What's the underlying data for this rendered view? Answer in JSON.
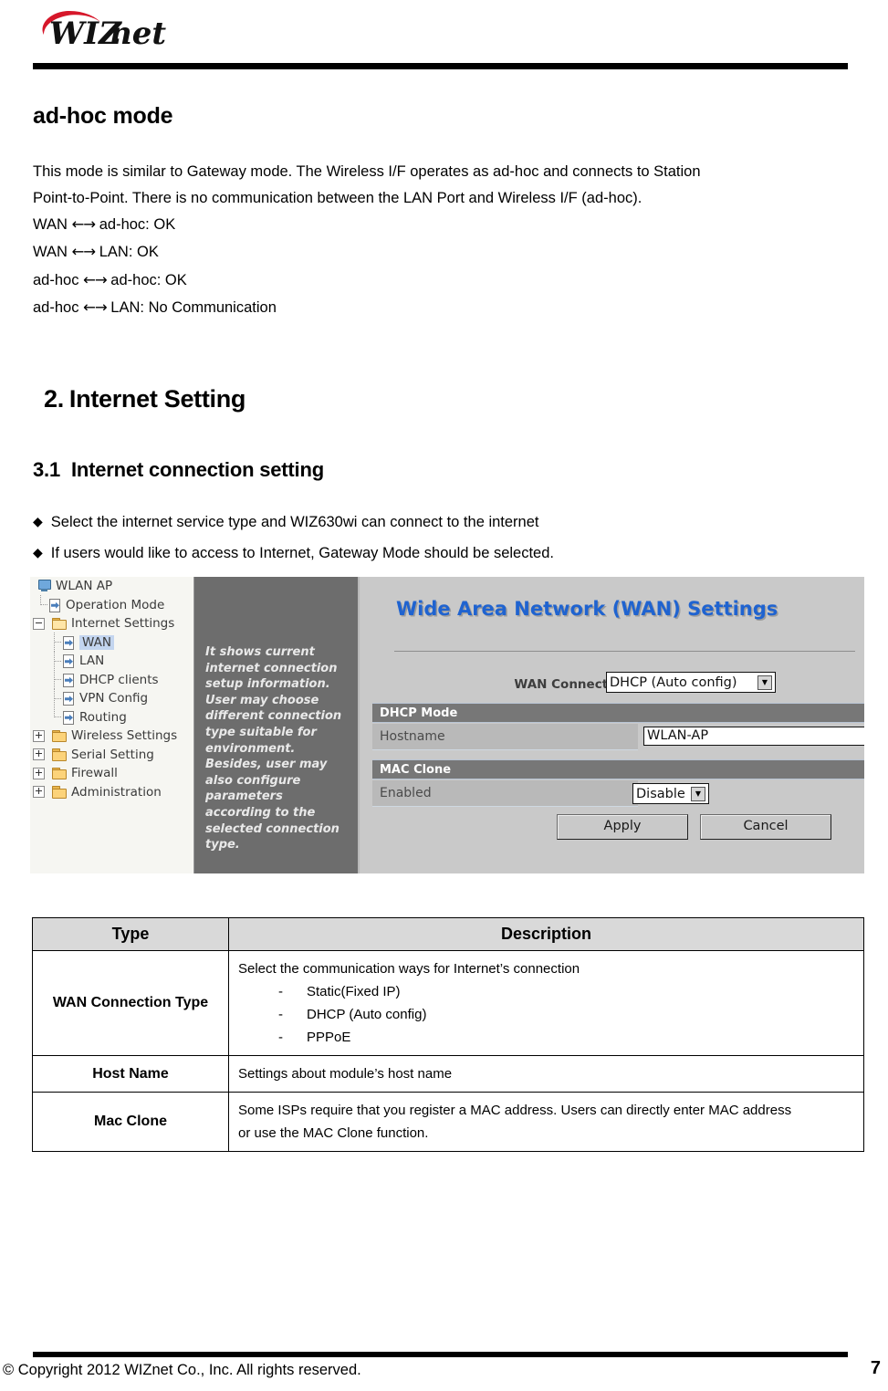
{
  "header": {
    "logo_text": "WIZnet"
  },
  "section": {
    "heading": "ad-hoc mode",
    "paragraph_line1": "This mode is similar to Gateway mode. The Wireless I/F operates as ad-hoc and connects to Station",
    "paragraph_line2": "Point-to-Point. There is no communication between the LAN Port and Wireless I/F (ad-hoc).",
    "mode_lines": [
      {
        "left": "WAN",
        "arrow": "←→",
        "right": "ad-hoc: OK"
      },
      {
        "left": "WAN",
        "arrow": "←→",
        "right": "LAN: OK"
      },
      {
        "left": "ad-hoc",
        "arrow": "←→",
        "right": "ad-hoc: OK"
      },
      {
        "left": "ad-hoc",
        "arrow": "←→",
        "right": "LAN: No Communication"
      }
    ]
  },
  "chapter": {
    "number": "2.",
    "title": "Internet Setting"
  },
  "subsection": {
    "number": "3.1",
    "title": "Internet connection setting",
    "bullets": [
      "Select the internet service type and WIZ630wi can connect to the internet",
      "If users would like to access to Internet, Gateway Mode should be selected."
    ],
    "bullet_glyph": "◆"
  },
  "screenshot": {
    "tree": {
      "root": "WLAN AP",
      "items": [
        {
          "label": "Operation Mode",
          "icon": "page-arrow-icon",
          "depth": 1,
          "selected": false,
          "expander": ""
        },
        {
          "label": "Internet Settings",
          "icon": "folder-open-icon",
          "depth": 1,
          "selected": false,
          "expander": "minus"
        },
        {
          "label": "WAN",
          "icon": "page-arrow-icon",
          "depth": 2,
          "selected": true,
          "expander": ""
        },
        {
          "label": "LAN",
          "icon": "page-arrow-icon",
          "depth": 2,
          "selected": false,
          "expander": ""
        },
        {
          "label": "DHCP clients",
          "icon": "page-arrow-icon",
          "depth": 2,
          "selected": false,
          "expander": ""
        },
        {
          "label": "VPN Config",
          "icon": "page-arrow-icon",
          "depth": 2,
          "selected": false,
          "expander": ""
        },
        {
          "label": "Routing",
          "icon": "page-arrow-icon",
          "depth": 2,
          "selected": false,
          "expander": ""
        },
        {
          "label": "Wireless Settings",
          "icon": "folder-icon",
          "depth": 1,
          "selected": false,
          "expander": "plus"
        },
        {
          "label": "Serial Setting",
          "icon": "folder-icon",
          "depth": 1,
          "selected": false,
          "expander": "plus"
        },
        {
          "label": "Firewall",
          "icon": "folder-icon",
          "depth": 1,
          "selected": false,
          "expander": "plus"
        },
        {
          "label": "Administration",
          "icon": "folder-icon",
          "depth": 1,
          "selected": false,
          "expander": "plus"
        }
      ]
    },
    "help_panel": {
      "text": "It shows current internet connection setup information. User may choose different connection type suitable for environment. Besides, user may also configure parameters according to the selected connection type."
    },
    "main": {
      "title": "Wide Area Network (WAN) Settings",
      "wan_type_label": "WAN Connection Type:",
      "wan_type_value": "DHCP (Auto config)",
      "section_dhcp": "DHCP Mode",
      "hostname_label": "Hostname",
      "hostname_value": "WLAN-AP",
      "section_mac": "MAC Clone",
      "enabled_label": "Enabled",
      "enabled_value": "Disable",
      "apply_label": "Apply",
      "cancel_label": "Cancel",
      "title_color": "#1f63d0"
    }
  },
  "table": {
    "headers": [
      "Type",
      "Description"
    ],
    "rows": [
      {
        "type": "WAN Connection Type",
        "desc_lead": "Select the communication ways for Internet’s connection",
        "desc_items": [
          "Static(Fixed IP)",
          "DHCP (Auto config)",
          "PPPoE"
        ],
        "desc_lines": []
      },
      {
        "type": "Host Name",
        "desc_lead": "",
        "desc_items": [],
        "desc_lines": [
          "Settings about module’s host name"
        ]
      },
      {
        "type": "Mac Clone",
        "desc_lead": "",
        "desc_items": [],
        "desc_lines": [
          "Some ISPs require that you register a MAC address. Users can directly enter MAC address",
          "or use the MAC Clone function."
        ]
      }
    ]
  },
  "footer": {
    "copyright": "© Copyright 2012 WIZnet Co., Inc. All rights reserved.",
    "page_number": "7"
  }
}
